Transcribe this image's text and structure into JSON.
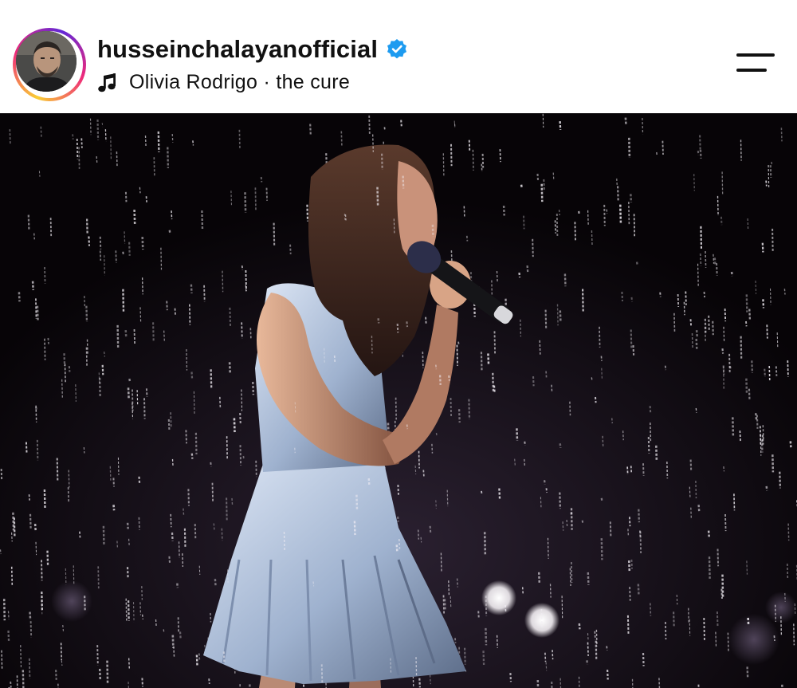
{
  "post": {
    "username": "husseinchalayanofficial",
    "verified": true,
    "music": {
      "icon": "music-note-icon",
      "text": "Olivia Rodrigo · the cure"
    },
    "menu_icon": "menu-icon"
  },
  "colors": {
    "verified_badge": "#1d9bf0",
    "ring_start": "#f9ce34",
    "ring_mid": "#ee2a7b",
    "ring_end": "#6228d7",
    "photo_background": "#080508"
  }
}
